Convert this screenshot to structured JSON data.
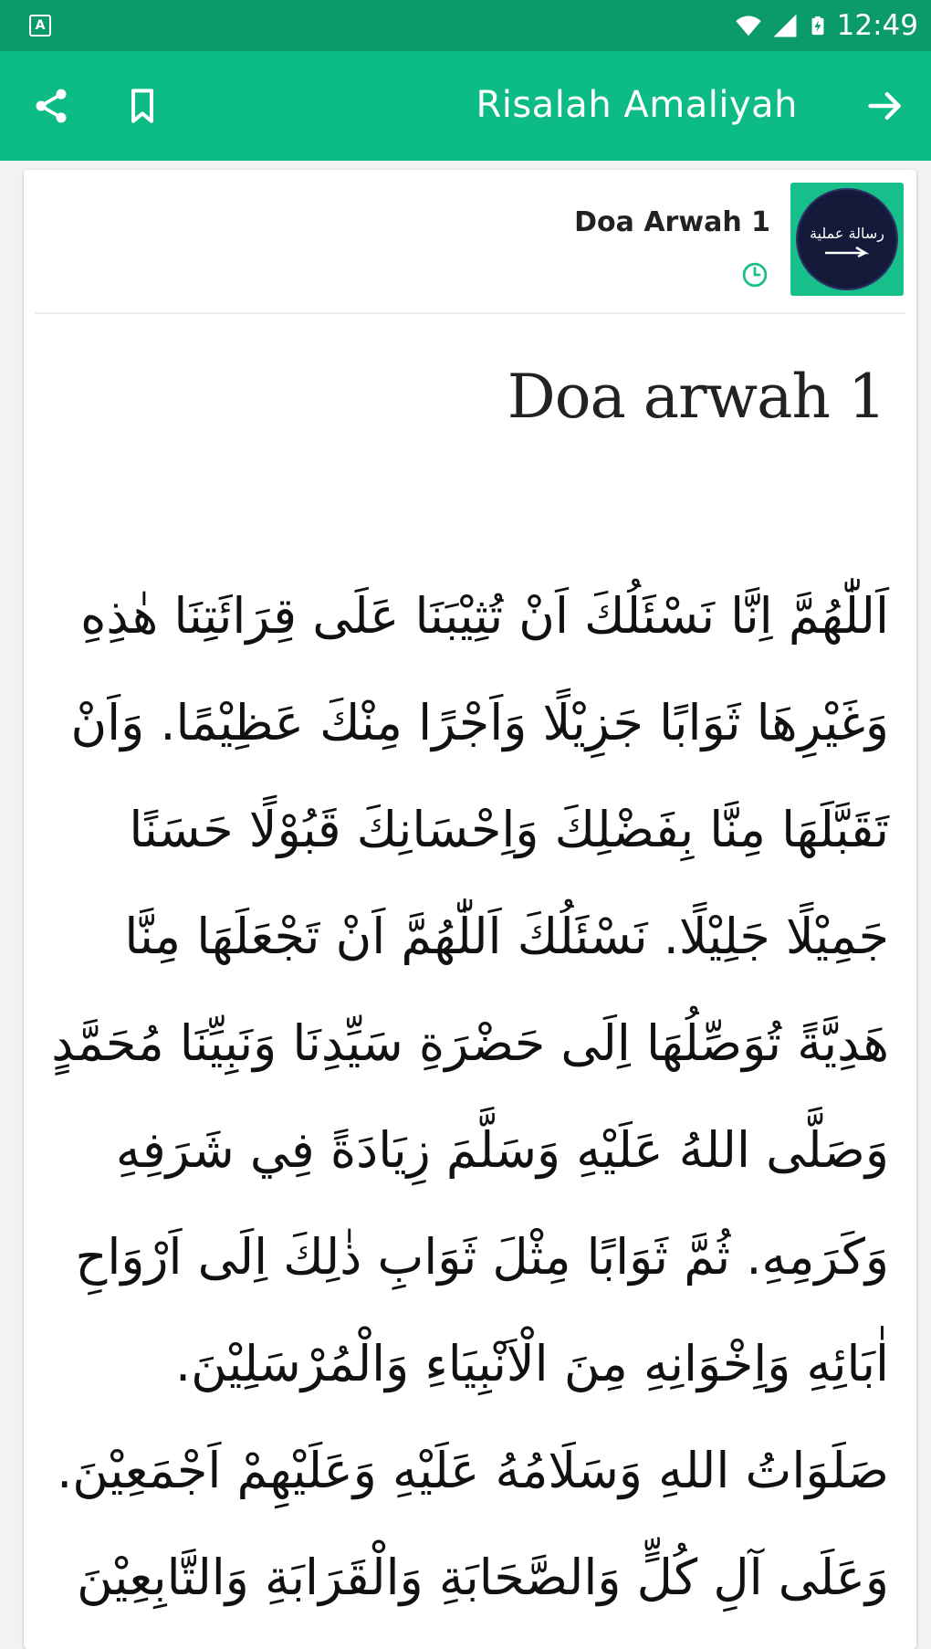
{
  "status_bar": {
    "notification_icon": "A",
    "icons": [
      "wifi-icon",
      "signal-icon",
      "battery-charging-icon"
    ],
    "time": "12:49"
  },
  "app_bar": {
    "title": "Risalah Amaliyah",
    "left_icons": [
      "share-icon",
      "bookmark-icon"
    ],
    "right_icon": "arrow-forward-icon",
    "background": "#0dbc85",
    "status_background": "#0a9a6c"
  },
  "post": {
    "title": "Doa Arwah 1",
    "thumbnail_text": "رسالة عملية",
    "meta_icon": "clock-icon",
    "accent": "#17c08a"
  },
  "content": {
    "heading": "Doa arwah 1",
    "arabic_lines": [
      "اَللّٰهُمَّ اِنَّا نَسْئَلُكَ اَنْ تُثِيْبَنَا عَلَى قِرَائَتِنَا هٰذِهِ",
      "وَغَيْرِهَا ثَوَابًا جَزِيْلًا وَاَجْرًا مِنْكَ عَظِيْمًا. وَاَنْ",
      "تَقَبَّلَهَا مِنَّا بِفَضْلِكَ وَاِحْسَانِكَ قَبُوْلًا حَسَنًا",
      "جَمِيْلًا جَلِيْلًا. نَسْئَلُكَ اَللّٰهُمَّ اَنْ تَجْعَلَهَا مِنَّا",
      "هَدِيَّةً تُوَصِّلُهَا اِلَى حَضْرَةِ سَيِّدِنَا وَنَبِيِّنَا مُحَمَّدٍ",
      "وَصَلَّى اللهُ عَلَيْهِ وَسَلَّمَ زِيَادَةً فِي شَرَفِهِ",
      "وَكَرَمِهِ. ثُمَّ ثَوَابًا مِثْلَ ثَوَابِ ذٰلِكَ اِلَى اَرْوَاحِ",
      "اٰبَائِهِ وَاِخْوَانِهِ مِنَ الْاَنْبِيَاءِ وَالْمُرْسَلِيْنَ.",
      "صَلَوَاتُ اللهِ وَسَلَامُهُ عَلَيْهِ وَعَلَيْهِمْ اَجْمَعِيْنَ.",
      "وَعَلَى آلِ كُلٍّ وَالصَّحَابَةِ وَالْقَرَابَةِ وَالتَّابِعِيْنَ"
    ]
  }
}
